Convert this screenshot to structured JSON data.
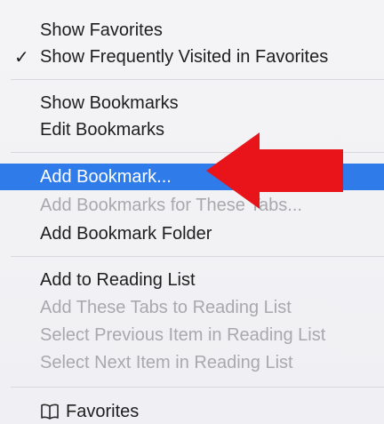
{
  "menu": {
    "section1": {
      "show_favorites": "Show Favorites",
      "check_mark": "✓",
      "show_frequently_visited": "Show Frequently Visited in Favorites"
    },
    "section2": {
      "show_bookmarks": "Show Bookmarks",
      "edit_bookmarks": "Edit Bookmarks"
    },
    "section3": {
      "add_bookmark": "Add Bookmark...",
      "add_bookmarks_for_tabs": "Add Bookmarks for These Tabs...",
      "add_bookmark_folder": "Add Bookmark Folder"
    },
    "section4": {
      "add_to_reading_list": "Add to Reading List",
      "add_tabs_to_reading_list": "Add These Tabs to Reading List",
      "select_previous": "Select Previous Item in Reading List",
      "select_next": "Select Next Item in Reading List"
    },
    "section5": {
      "favorites_icon": "book-icon",
      "favorites": "Favorites"
    }
  },
  "colors": {
    "selection": "#2f7bea",
    "annotation_arrow": "#e8141a",
    "disabled_text": "#a9a9ad"
  }
}
